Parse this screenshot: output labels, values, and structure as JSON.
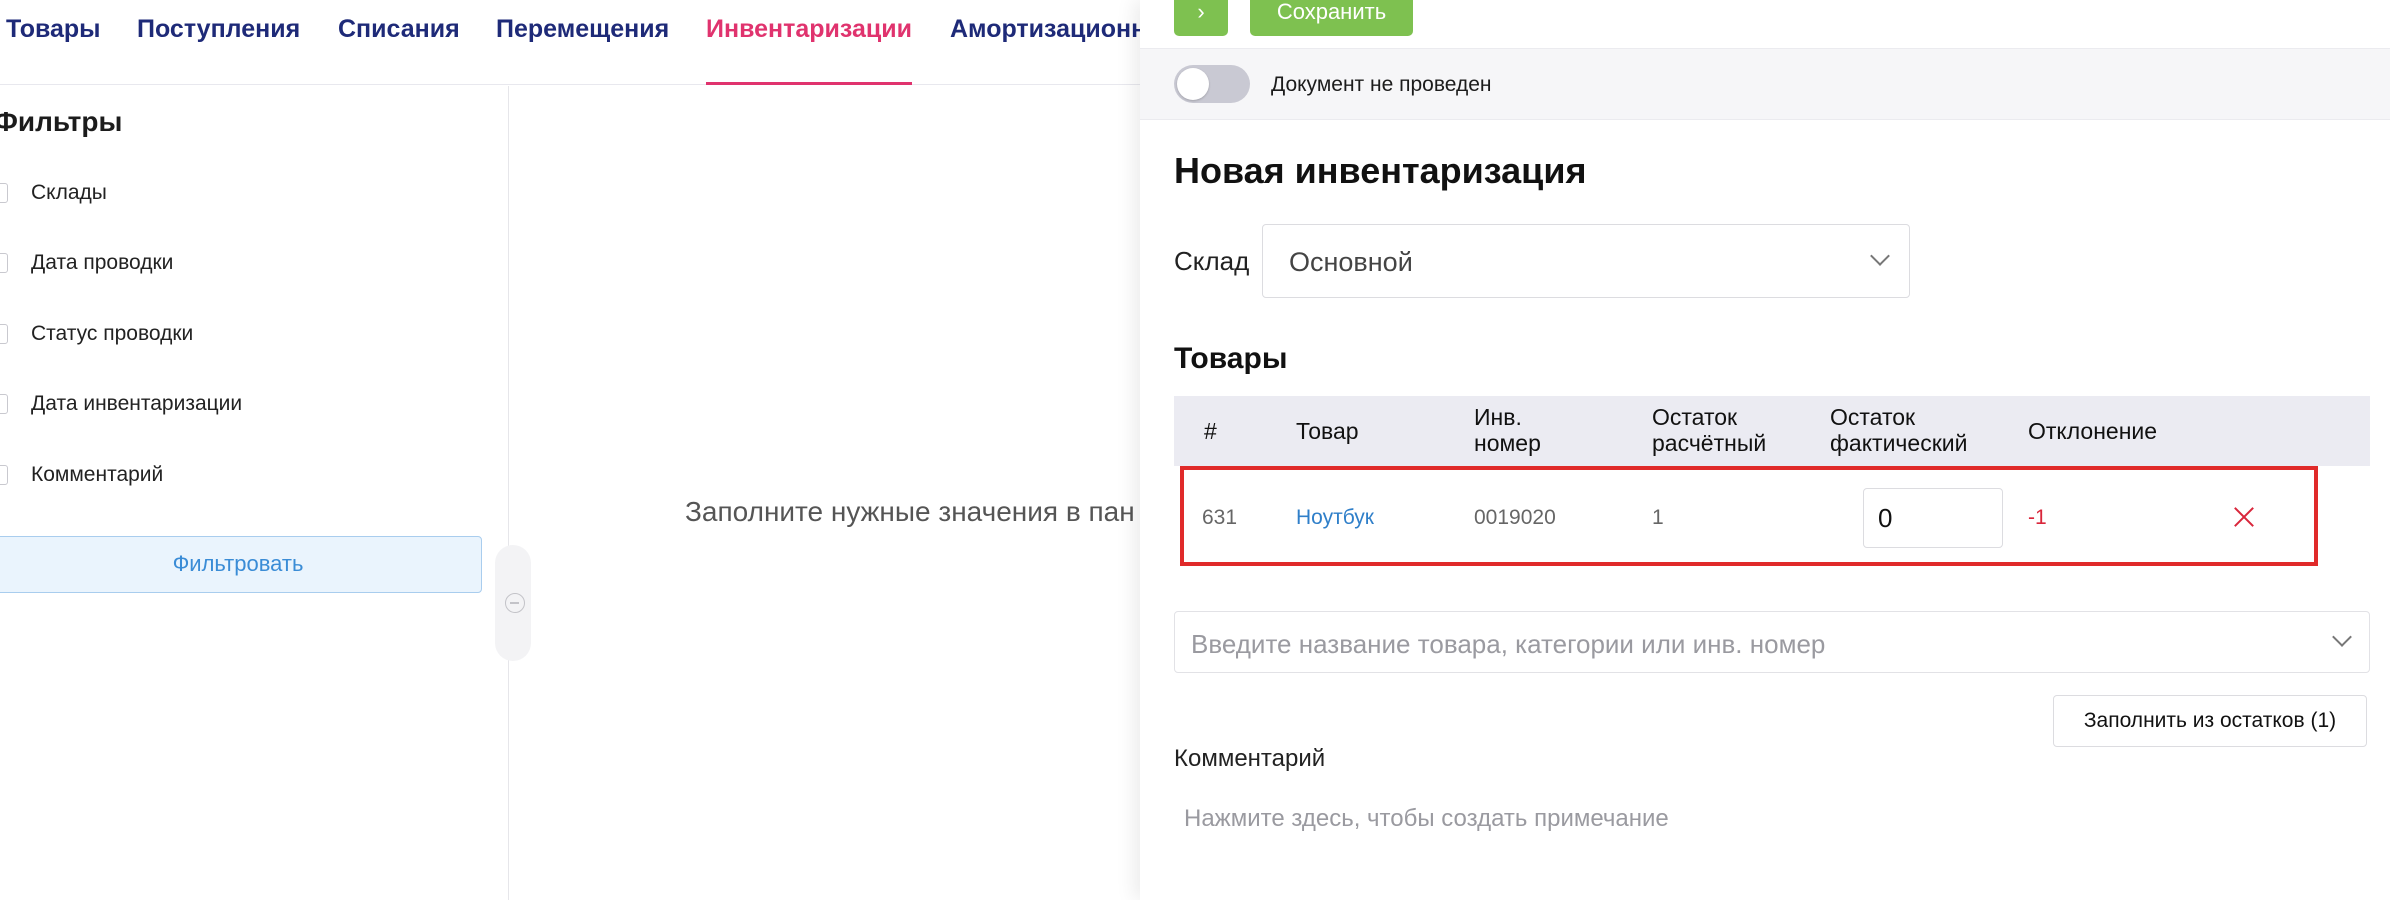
{
  "nav": {
    "tabs": [
      {
        "label": "Товары",
        "active": false
      },
      {
        "label": "Поступления",
        "active": false
      },
      {
        "label": "Списания",
        "active": false
      },
      {
        "label": "Перемещения",
        "active": false
      },
      {
        "label": "Инвентаризации",
        "active": true
      },
      {
        "label": "Амортизационн",
        "active": false
      }
    ]
  },
  "filters": {
    "title": "Фильтры",
    "items": [
      {
        "label": "Склады"
      },
      {
        "label": "Дата проводки"
      },
      {
        "label": "Статус проводки"
      },
      {
        "label": "Дата инвентаризации"
      },
      {
        "label": "Комментарий"
      }
    ],
    "apply_button": "Фильтровать"
  },
  "main": {
    "empty_message": "Заполните нужные значения в пан"
  },
  "panel": {
    "next_button": "›",
    "save_button": "Сохранить",
    "status_text": "Документ не проведен",
    "title": "Новая инвентаризация",
    "warehouse_label": "Склад",
    "warehouse_value": "Основной",
    "products_title": "Товары",
    "table": {
      "headers": {
        "num": "#",
        "product": "Товар",
        "inv_number_1": "Инв.",
        "inv_number_2": "номер",
        "calc_1": "Остаток",
        "calc_2": "расчётный",
        "actual_1": "Остаток",
        "actual_2": "фактический",
        "deviation": "Отклонение"
      },
      "rows": [
        {
          "num": "631",
          "product": "Ноутбук",
          "inv_number": "0019020",
          "calc_rest": "1",
          "actual_rest": "0",
          "deviation": "-1"
        }
      ]
    },
    "product_search_placeholder": "Введите название товара, категории или инв. номер",
    "fill_button": "Заполнить из остатков (1)",
    "comment_label": "Комментарий",
    "comment_placeholder": "Нажмите здесь, чтобы создать примечание"
  },
  "colors": {
    "nav_text": "#1e2a78",
    "nav_active": "#e0336e",
    "save_green": "#7ec150",
    "link_blue": "#2f7fc9",
    "negative_red": "#d9263b",
    "highlight_red": "#e02a2a"
  }
}
